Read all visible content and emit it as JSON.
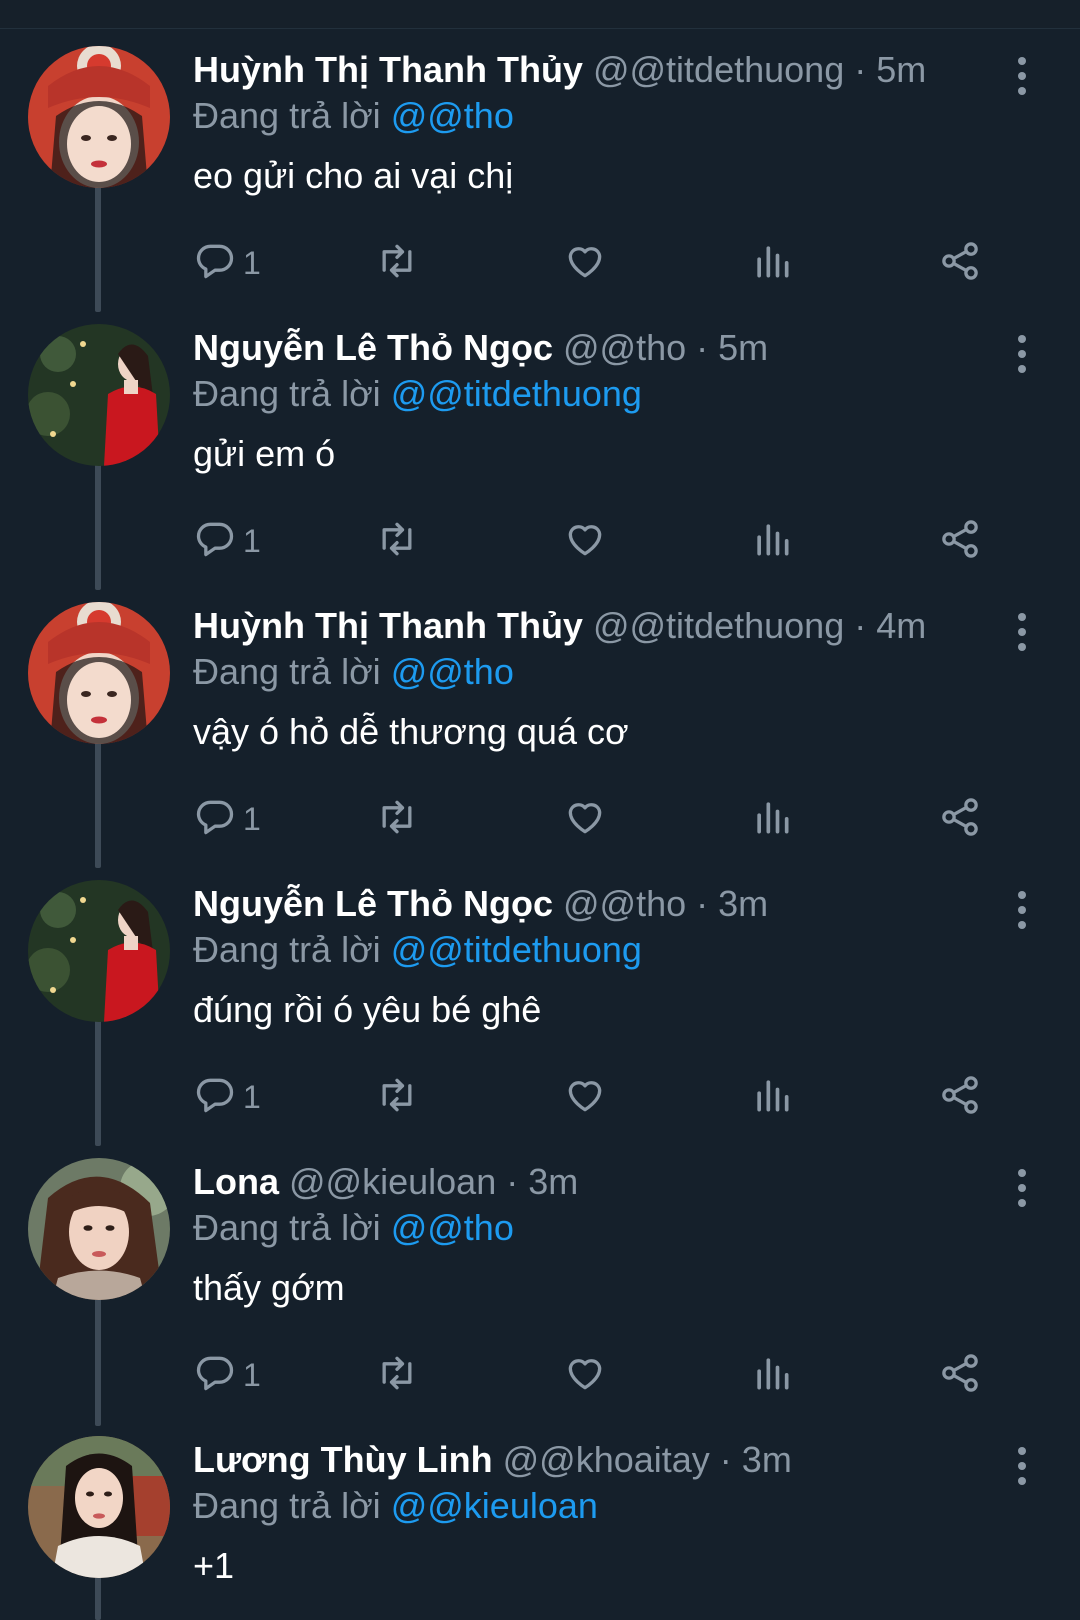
{
  "reply_label": "Đang trả lời",
  "colors": {
    "background": "#15202b",
    "mention": "#1d9bf0",
    "muted": "#8b98a5",
    "thread_line": "#3d4a57"
  },
  "icons": {
    "reply": "reply-icon",
    "retweet": "retweet-icon",
    "like": "heart-icon",
    "views": "analytics-icon",
    "share": "share-icon",
    "more": "more-vertical-icon"
  },
  "tweets": [
    {
      "name": "Huỳnh Thị Thanh Thủy",
      "meta": "@@titdethuong · 5m",
      "reply_to": "@@tho",
      "text": "eo gửi cho ai vại chị",
      "reply_count": "1"
    },
    {
      "name": "Nguyễn Lê Thỏ Ngọc",
      "meta": "@@tho · 5m",
      "reply_to": "@@titdethuong",
      "text": "gửi em ó",
      "reply_count": "1"
    },
    {
      "name": "Huỳnh Thị Thanh Thủy",
      "meta": "@@titdethuong · 4m",
      "reply_to": "@@tho",
      "text": "vậy ó hỏ dễ thương quá cơ",
      "reply_count": "1"
    },
    {
      "name": "Nguyễn Lê Thỏ Ngọc",
      "meta": "@@tho · 3m",
      "reply_to": "@@titdethuong",
      "text": "đúng rồi ó yêu bé ghê",
      "reply_count": "1"
    },
    {
      "name": "Lona",
      "meta": "@@kieuloan · 3m",
      "reply_to": "@@tho",
      "text": "thấy gớm",
      "reply_count": "1"
    },
    {
      "name": "Lương Thùy Linh",
      "meta": "@@khoaitay · 3m",
      "reply_to": "@@kieuloan",
      "text": "+1",
      "reply_count": ""
    }
  ]
}
